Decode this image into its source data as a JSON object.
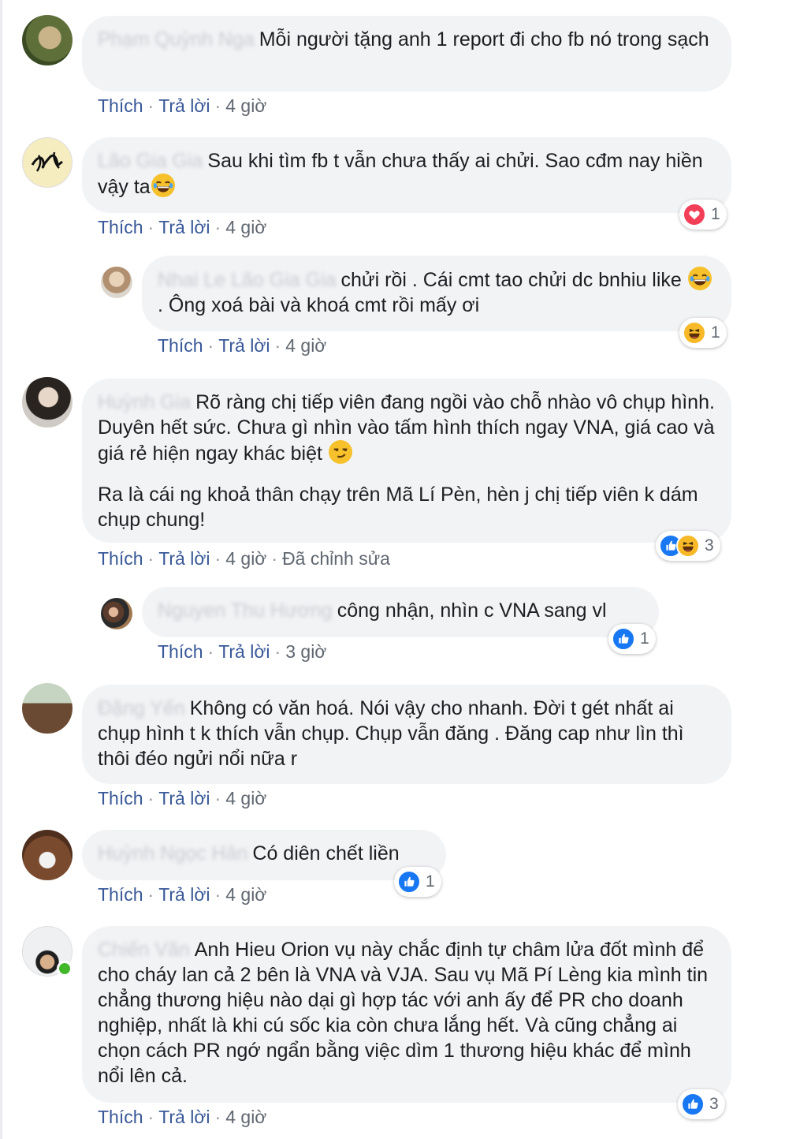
{
  "actions": {
    "like": "Thích",
    "reply": "Trả lời",
    "edited": "Đã chỉnh sửa"
  },
  "comments": [
    {
      "author": "Phạm Quỳnh Nga",
      "text": "Mỗi người tặng anh 1 report đi cho fb nó trong sạch",
      "time": "4 giờ"
    },
    {
      "author": "Lão Gia Gia",
      "text": "Sau khi tìm fb t vẫn chưa thấy ai chửi. Sao cđm nay hiền vậy ta",
      "emoji": "joy",
      "time": "4 giờ",
      "reactions": {
        "types": [
          "love"
        ],
        "count": "1"
      }
    },
    {
      "author": "Nhai Le Lão Gia Gia",
      "text_a": "chửi rồi . Cái cmt tao chửi dc bnhiu like ",
      "emoji": "joy",
      "text_b": ". Ông xoá bài và khoá cmt rồi mấy ơi",
      "time": "4 giờ",
      "reactions": {
        "types": [
          "haha"
        ],
        "count": "1"
      }
    },
    {
      "author": "Huỳnh Gia",
      "text_a": "Rõ ràng chị tiếp viên đang ngồi vào chỗ nhào vô chụp hình. Duyên hết sức. Chưa gì nhìn vào tấm hình thích ngay VNA, giá cao và giá rẻ hiện ngay khác biệt",
      "emoji": "smirk",
      "text_b": "Ra là cái ng khoả thân chạy trên Mã Lí Pèn, hèn j chị tiếp viên k dám chụp chung!",
      "time": "4 giờ",
      "reactions": {
        "types": [
          "like",
          "haha"
        ],
        "count": "3"
      }
    },
    {
      "author": "Nguyen Thu Hương",
      "text": "công nhận, nhìn c VNA sang vl",
      "time": "3 giờ",
      "reactions": {
        "types": [
          "like"
        ],
        "count": "1"
      }
    },
    {
      "author": "Đặng Yến",
      "text": "Không có văn hoá. Nói vậy cho nhanh. Đời t gét nhất ai chụp hình t k thích vẫn chụp. Chụp vẫn đăng . Đăng cap như lìn thì thôi đéo ngửi nổi nữa r",
      "time": "4 giờ"
    },
    {
      "author": "Huỳnh Ngọc Hân",
      "text": "Có diên chết liền",
      "time": "4 giờ",
      "reactions": {
        "types": [
          "like"
        ],
        "count": "1"
      }
    },
    {
      "author": "Chiến Văn",
      "text": "Anh Hieu Orion vụ này chắc định tự châm lửa đốt mình để cho cháy lan cả 2 bên là VNA và VJA. Sau vụ Mã Pí Lèng kia mình tin chẳng thương hiệu nào dại gì hợp tác với anh ấy để PR cho doanh nghiệp, nhất là khi cú sốc kia còn chưa lắng hết. Và cũng chẳng ai chọn cách PR ngớ ngẩn bằng việc dìm 1 thương hiệu khác để mình nổi lên cả.",
      "time": "4 giờ",
      "online": true,
      "reactions": {
        "types": [
          "like"
        ],
        "count": "3"
      }
    }
  ]
}
